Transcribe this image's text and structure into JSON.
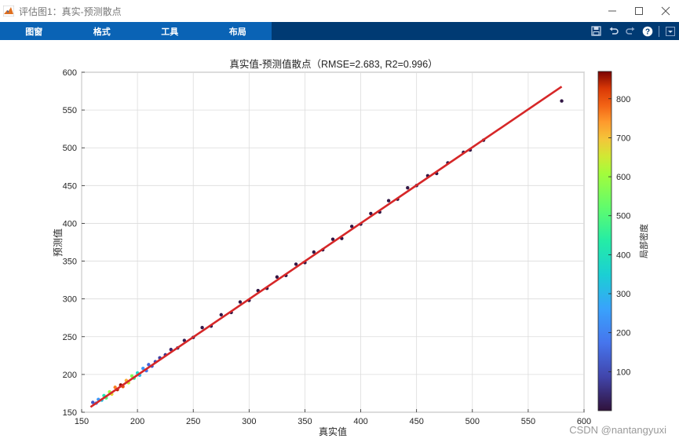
{
  "window": {
    "title": "评估图1：真实-预测散点",
    "controls": [
      "minimize-icon",
      "maximize-icon",
      "close-icon"
    ]
  },
  "toolstrip": {
    "tabs": [
      "图窗",
      "格式",
      "工具",
      "布局"
    ],
    "tools": [
      "save-icon",
      "undo-icon",
      "redo-icon",
      "help-icon",
      "expand-toolstrip-icon"
    ],
    "tabs_color": "#0a63b5",
    "bar_color": "#003a73"
  },
  "chart_data": {
    "type": "scatter",
    "title": "真实值-预测值散点（RMSE=2.683, R2=0.996）",
    "xlabel": "真实值",
    "ylabel": "预测值",
    "xlim": [
      150,
      600
    ],
    "ylim": [
      150,
      600
    ],
    "xticks": [
      150,
      200,
      250,
      300,
      350,
      400,
      450,
      500,
      550,
      600
    ],
    "yticks": [
      150,
      200,
      250,
      300,
      350,
      400,
      450,
      500,
      550,
      600
    ],
    "grid": true,
    "colorbar": {
      "label": "局部密度",
      "range": [
        0,
        870
      ],
      "ticks": [
        100,
        200,
        300,
        400,
        500,
        600,
        700,
        800
      ],
      "colormap": "turbo"
    },
    "fit_line": {
      "x": [
        158,
        580
      ],
      "y": [
        157,
        581
      ],
      "color": "#d62728"
    },
    "points": [
      {
        "x": 160,
        "y": 163,
        "d": 120
      },
      {
        "x": 163,
        "y": 162,
        "d": 180
      },
      {
        "x": 165,
        "y": 167,
        "d": 240
      },
      {
        "x": 168,
        "y": 166,
        "d": 320
      },
      {
        "x": 170,
        "y": 172,
        "d": 420
      },
      {
        "x": 172,
        "y": 169,
        "d": 500
      },
      {
        "x": 175,
        "y": 177,
        "d": 600
      },
      {
        "x": 177,
        "y": 174,
        "d": 680
      },
      {
        "x": 180,
        "y": 183,
        "d": 760
      },
      {
        "x": 182,
        "y": 180,
        "d": 840
      },
      {
        "x": 185,
        "y": 186,
        "d": 860
      },
      {
        "x": 187,
        "y": 184,
        "d": 800
      },
      {
        "x": 190,
        "y": 192,
        "d": 720
      },
      {
        "x": 192,
        "y": 189,
        "d": 640
      },
      {
        "x": 195,
        "y": 198,
        "d": 560
      },
      {
        "x": 197,
        "y": 195,
        "d": 470
      },
      {
        "x": 200,
        "y": 202,
        "d": 380
      },
      {
        "x": 202,
        "y": 199,
        "d": 300
      },
      {
        "x": 205,
        "y": 208,
        "d": 240
      },
      {
        "x": 208,
        "y": 205,
        "d": 180
      },
      {
        "x": 210,
        "y": 213,
        "d": 150
      },
      {
        "x": 213,
        "y": 211,
        "d": 120
      },
      {
        "x": 216,
        "y": 217,
        "d": 100
      },
      {
        "x": 220,
        "y": 222,
        "d": 80
      },
      {
        "x": 225,
        "y": 226,
        "d": 60
      },
      {
        "x": 230,
        "y": 233,
        "d": 40
      },
      {
        "x": 236,
        "y": 235,
        "d": 30
      },
      {
        "x": 242,
        "y": 245,
        "d": 20
      },
      {
        "x": 250,
        "y": 249,
        "d": 15
      },
      {
        "x": 258,
        "y": 262,
        "d": 12
      },
      {
        "x": 266,
        "y": 264,
        "d": 10
      },
      {
        "x": 275,
        "y": 279,
        "d": 10
      },
      {
        "x": 284,
        "y": 282,
        "d": 8
      },
      {
        "x": 292,
        "y": 296,
        "d": 8
      },
      {
        "x": 300,
        "y": 298,
        "d": 8
      },
      {
        "x": 308,
        "y": 311,
        "d": 8
      },
      {
        "x": 316,
        "y": 314,
        "d": 8
      },
      {
        "x": 325,
        "y": 329,
        "d": 8
      },
      {
        "x": 333,
        "y": 331,
        "d": 8
      },
      {
        "x": 342,
        "y": 346,
        "d": 8
      },
      {
        "x": 350,
        "y": 348,
        "d": 8
      },
      {
        "x": 358,
        "y": 362,
        "d": 8
      },
      {
        "x": 366,
        "y": 365,
        "d": 8
      },
      {
        "x": 375,
        "y": 379,
        "d": 8
      },
      {
        "x": 383,
        "y": 380,
        "d": 8
      },
      {
        "x": 392,
        "y": 396,
        "d": 8
      },
      {
        "x": 400,
        "y": 399,
        "d": 8
      },
      {
        "x": 409,
        "y": 413,
        "d": 8
      },
      {
        "x": 417,
        "y": 415,
        "d": 8
      },
      {
        "x": 425,
        "y": 430,
        "d": 8
      },
      {
        "x": 433,
        "y": 432,
        "d": 8
      },
      {
        "x": 442,
        "y": 447,
        "d": 8
      },
      {
        "x": 450,
        "y": 450,
        "d": 8
      },
      {
        "x": 460,
        "y": 463,
        "d": 8
      },
      {
        "x": 468,
        "y": 466,
        "d": 8
      },
      {
        "x": 478,
        "y": 480,
        "d": 8
      },
      {
        "x": 492,
        "y": 494,
        "d": 8
      },
      {
        "x": 498,
        "y": 497,
        "d": 8
      },
      {
        "x": 510,
        "y": 510,
        "d": 8
      },
      {
        "x": 580,
        "y": 562,
        "d": 8
      }
    ]
  },
  "watermark": "CSDN @nantangyuxi"
}
